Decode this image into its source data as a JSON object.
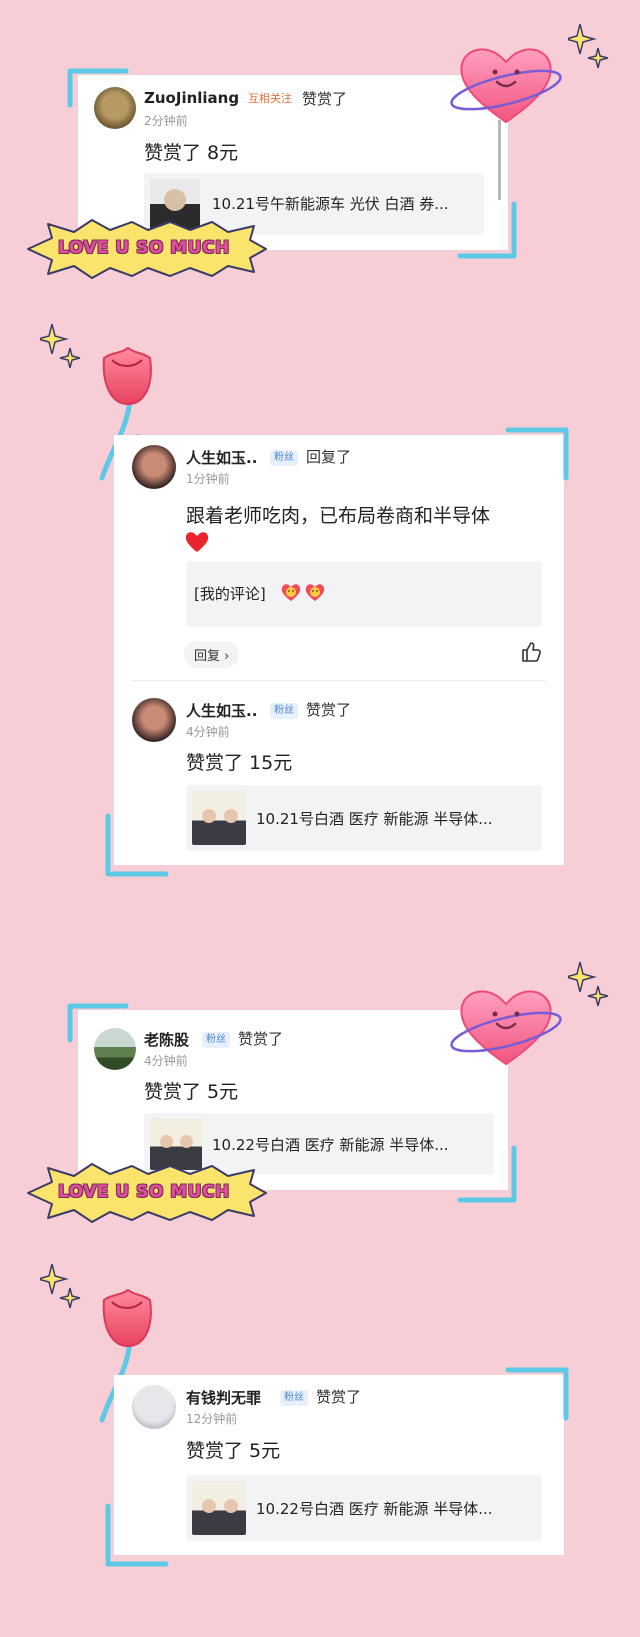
{
  "colors": {
    "background": "#f7cdd6",
    "frame_blue": "#5cc9e6",
    "tag_blue": "#4a86d9",
    "tag_orange": "#e0713a"
  },
  "sticker": {
    "text": "LOVE U SO MUCH"
  },
  "notifications": [
    {
      "user": "ZuoJinliang",
      "tag": "互相关注",
      "action": "赞赏了",
      "time": "2分钟前",
      "message": "赞赏了 8元",
      "ref_title": "10.21号午新能源车 光伏 白酒 券..."
    },
    {
      "user": "人生如玉..",
      "tag": "粉丝",
      "action": "回复了",
      "time": "1分钟前",
      "message_line1": "跟着老师吃肉，已布局卷商和半导体",
      "emoji": "❤️",
      "my_comment": "[我的评论]",
      "reply_label": "回复",
      "reply_chevron": "›",
      "like_icon": "thumbs-up"
    },
    {
      "user": "人生如玉..",
      "tag": "粉丝",
      "action": "赞赏了",
      "time": "4分钟前",
      "message": "赞赏了 15元",
      "ref_title": "10.21号白酒 医疗 新能源 半导体..."
    },
    {
      "user": "老陈股",
      "tag": "粉丝",
      "action": "赞赏了",
      "time": "4分钟前",
      "message": "赞赏了 5元",
      "ref_title": "10.22号白酒 医疗 新能源 半导体..."
    },
    {
      "user": "有钱判无罪",
      "tag": "粉丝",
      "action": "赞赏了",
      "time": "12分钟前",
      "message": "赞赏了 5元",
      "ref_title": "10.22号白酒 医疗 新能源 半导体..."
    }
  ]
}
